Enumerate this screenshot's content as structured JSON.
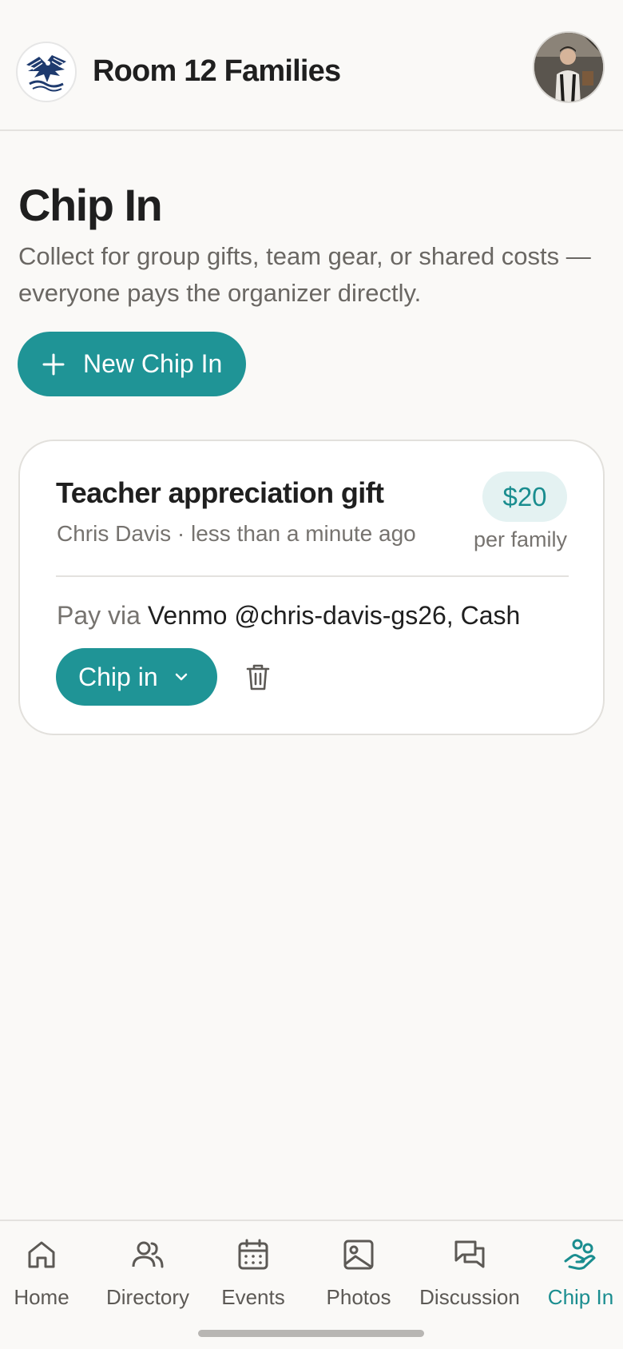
{
  "header": {
    "group_name": "Room 12 Families"
  },
  "page": {
    "title": "Chip In",
    "description": "Collect for group gifts, team gear, or shared costs — everyone pays the organizer directly.",
    "new_button_label": "New Chip In"
  },
  "chip_ins": [
    {
      "title": "Teacher appreciation gift",
      "meta": "Chris Davis · less than a minute ago",
      "amount": "$20",
      "amount_unit": "per family",
      "pay_prefix": "Pay via",
      "pay_methods": "Venmo @chris-davis-gs26, Cash",
      "action_label": "Chip in"
    }
  ],
  "bottom_nav": {
    "items": [
      {
        "label": "Home",
        "icon": "home-icon",
        "active": false
      },
      {
        "label": "Directory",
        "icon": "people-icon",
        "active": false
      },
      {
        "label": "Events",
        "icon": "calendar-icon",
        "active": false
      },
      {
        "label": "Photos",
        "icon": "image-icon",
        "active": false
      },
      {
        "label": "Discussion",
        "icon": "chat-icon",
        "active": false
      },
      {
        "label": "Chip In",
        "icon": "hand-coins-icon",
        "active": true
      }
    ]
  },
  "colors": {
    "accent": "#1f9496",
    "accent_text": "#1a8d8f",
    "badge_bg": "#e4f2f2",
    "background": "#faf9f7"
  }
}
